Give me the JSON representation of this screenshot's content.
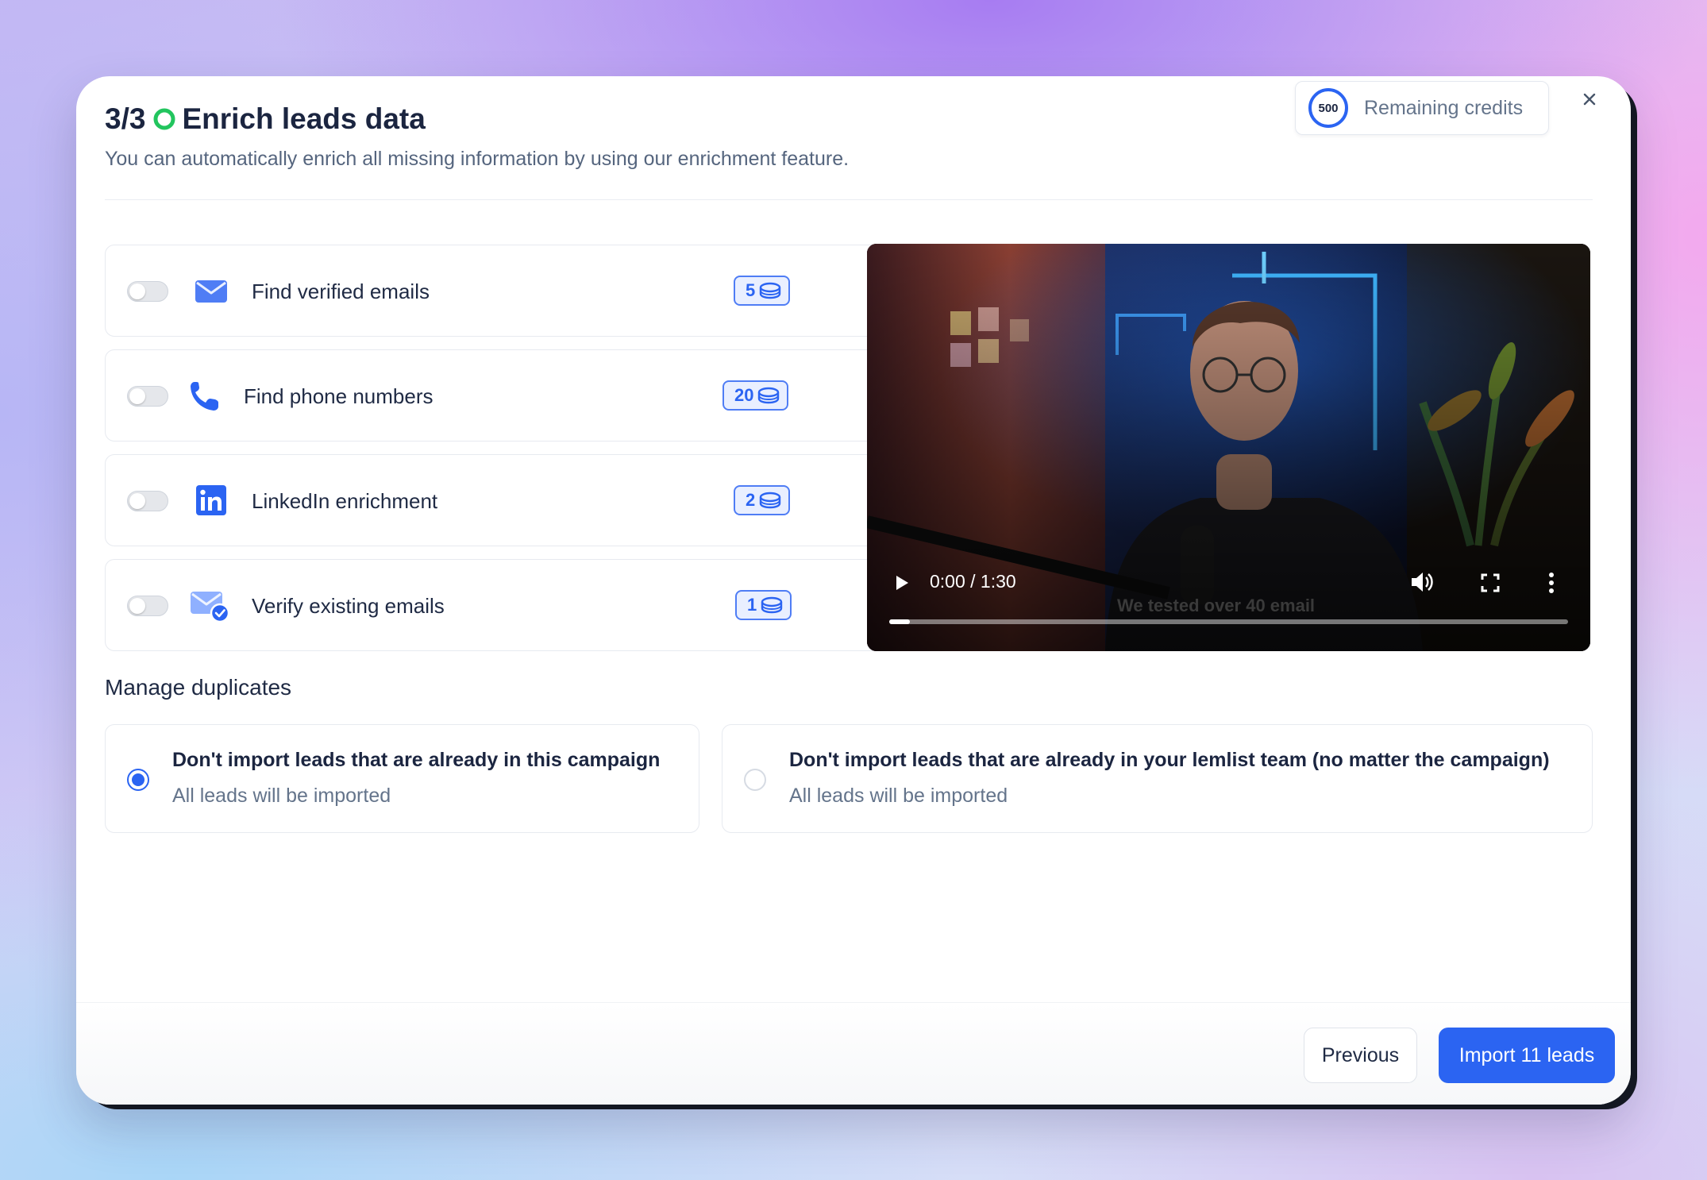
{
  "modal": {
    "step": "3/3",
    "title": "Enrich leads data",
    "subtitle": "You can automatically enrich all missing information by using our enrichment feature.",
    "credits": {
      "value": "500",
      "label": "Remaining credits"
    },
    "close_icon": "close-icon"
  },
  "features": [
    {
      "label": "Find verified emails",
      "cost": "5",
      "icon": "envelope-icon",
      "enabled": false
    },
    {
      "label": "Find phone numbers",
      "cost": "20",
      "icon": "phone-icon",
      "enabled": false
    },
    {
      "label": "LinkedIn enrichment",
      "cost": "2",
      "icon": "linkedin-icon",
      "enabled": false
    },
    {
      "label": "Verify existing emails",
      "cost": "1",
      "icon": "envelope-check-icon",
      "enabled": false
    }
  ],
  "video": {
    "time": "0:00 / 1:30",
    "caption": "We tested over 40 email",
    "progress": 0.03
  },
  "duplicates": {
    "heading": "Manage duplicates",
    "options": [
      {
        "title": "Don't import leads that are already in this campaign",
        "subtitle": "All leads will be imported",
        "selected": true
      },
      {
        "title": "Don't import leads that are already in your lemlist team (no matter the campaign)",
        "subtitle": "All leads will be imported",
        "selected": false
      }
    ]
  },
  "footer": {
    "previous_label": "Previous",
    "import_label": "Import 11 leads"
  },
  "colors": {
    "accent": "#2b64f2",
    "progress_green": "#22c55e",
    "text_primary": "#1b2540",
    "text_secondary": "#64748b"
  }
}
